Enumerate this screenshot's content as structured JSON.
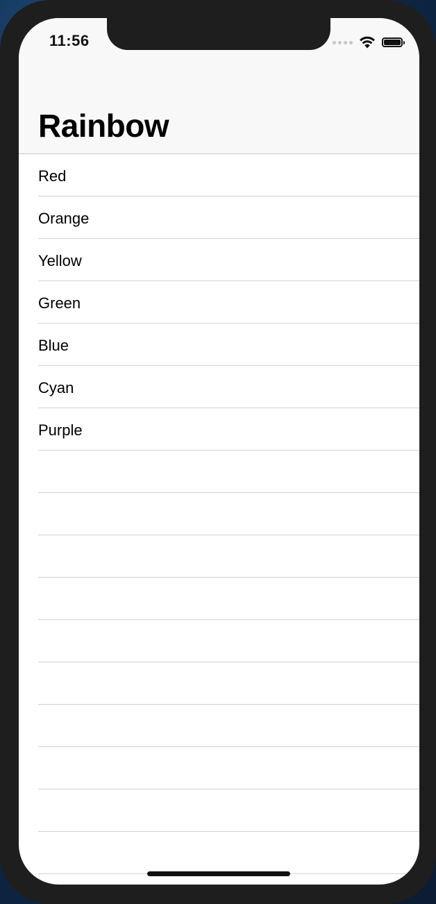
{
  "status_bar": {
    "time": "11:56",
    "icons": [
      "cellular-signal-icon",
      "wifi-icon",
      "battery-icon"
    ]
  },
  "nav": {
    "title": "Rainbow"
  },
  "list": {
    "items": [
      "Red",
      "Orange",
      "Yellow",
      "Green",
      "Blue",
      "Cyan",
      "Purple",
      "",
      "",
      "",
      "",
      "",
      "",
      "",
      "",
      "",
      ""
    ]
  },
  "colors": {
    "navbar_bg": "#f8f8f8",
    "separator": "#d1d1d6",
    "device_frame": "#1e1e1e"
  }
}
